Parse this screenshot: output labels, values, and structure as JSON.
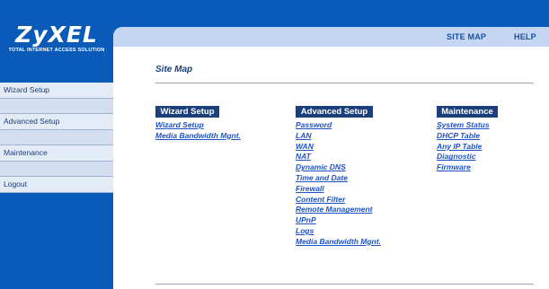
{
  "brand": {
    "name": "ZyXEL",
    "tagline": "Total Internet Access Solution"
  },
  "header": {
    "site_map_label": "SITE MAP",
    "help_label": "HELP"
  },
  "sidebar": {
    "items": [
      {
        "label": "Wizard Setup"
      },
      {
        "label": "Advanced Setup"
      },
      {
        "label": "Maintenance"
      },
      {
        "label": "Logout"
      }
    ]
  },
  "main": {
    "title": "Site Map",
    "columns": [
      {
        "heading": "Wizard Setup",
        "links": [
          "Wizard Setup",
          "Media Bandwidth Mgnt."
        ]
      },
      {
        "heading": "Advanced Setup",
        "links": [
          "Password",
          "LAN",
          "WAN",
          "NAT",
          "Dynamic DNS",
          "Time and Date",
          "Firewall",
          "Content Filter",
          "Remote Management",
          "UPnP",
          "Logs",
          "Media Bandwidth Mgnt."
        ]
      },
      {
        "heading": "Maintenance",
        "links": [
          "System Status",
          "DHCP Table",
          "Any IP Table",
          "Diagnostic",
          "Firmware"
        ]
      }
    ]
  },
  "colors": {
    "primary_blue": "#0a5ab9",
    "header_band": "#c4d6f2",
    "section_heading_bg": "#1b3f7a",
    "link": "#1d52c4"
  }
}
